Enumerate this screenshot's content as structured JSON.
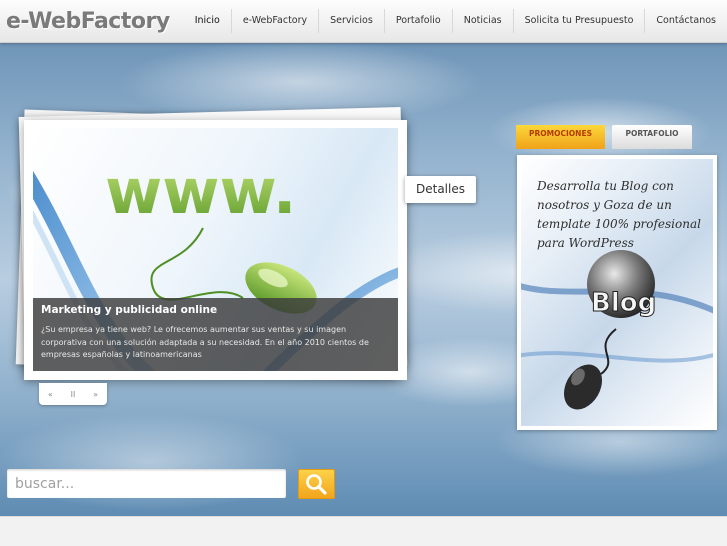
{
  "brand": {
    "logo": "e-WebFactory"
  },
  "nav": [
    {
      "label": "Inicio",
      "active": true
    },
    {
      "label": "e-WebFactory"
    },
    {
      "label": "Servicios"
    },
    {
      "label": "Portafolio"
    },
    {
      "label": "Noticias"
    },
    {
      "label": "Solicita tu Presupuesto"
    },
    {
      "label": "Contáctanos"
    }
  ],
  "slide": {
    "image_text": "www.",
    "title": "Marketing y publicidad online",
    "text": "¿Su empresa ya tiene web? Le ofrecemos aumentar sus ventas y su imagen corporativa con una solución adaptada a su necesidad. En el año 2010 cientos de empresas españolas y latinoamericanas",
    "details_label": "Detalles",
    "controls": {
      "prev": "«",
      "pause": "II",
      "next": "»"
    }
  },
  "tabs": {
    "promociones": "PROMOCIONES",
    "portafolio": "PORTAFOLIO"
  },
  "promo": {
    "text": "Desarrolla tu Blog con nosotros y Goza de un template 100% profesional para WordPress",
    "badge": "Blog"
  },
  "search": {
    "placeholder": "buscar..."
  },
  "colors": {
    "accent": "#f5b526",
    "promo_tab_text": "#b33a00",
    "caption_bg": "#3c3c3c"
  },
  "icons": {
    "search": "magnifier-icon"
  }
}
